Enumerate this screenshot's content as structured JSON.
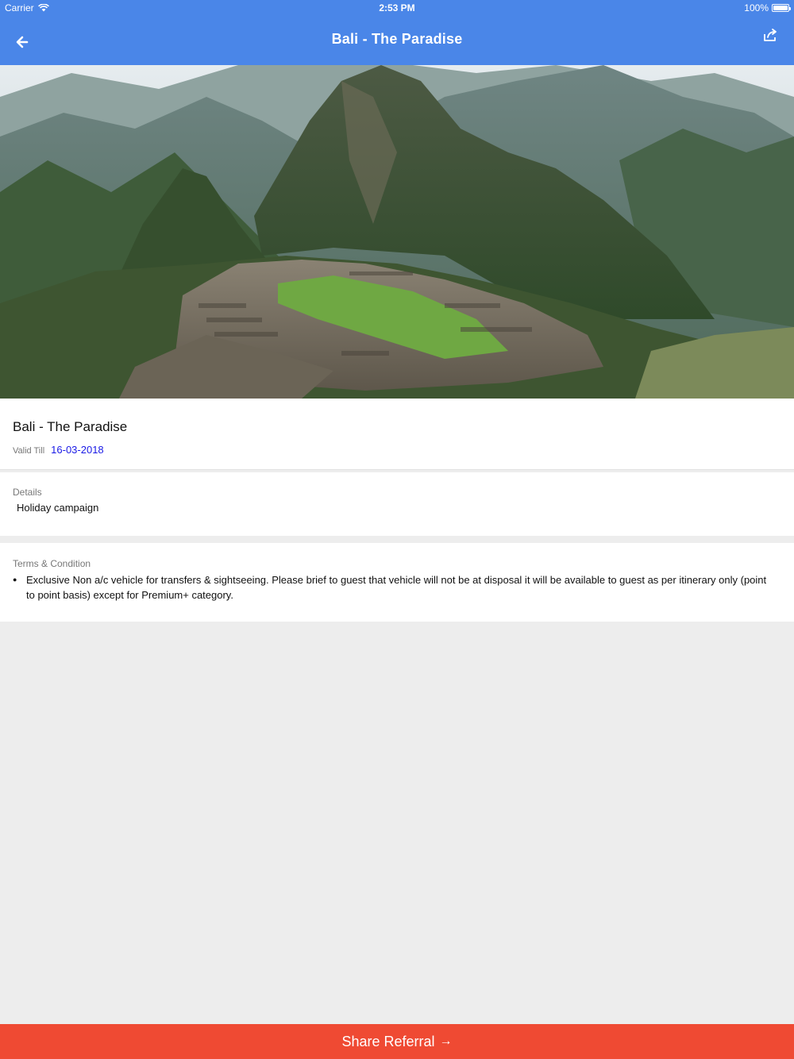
{
  "status_bar": {
    "carrier": "Carrier",
    "time": "2:53 PM",
    "battery": "100%"
  },
  "nav": {
    "title": "Bali - The Paradise",
    "back_icon": "arrow-left-icon",
    "share_icon": "share-icon"
  },
  "hero": {
    "image": "mountain-landscape"
  },
  "offer": {
    "title": "Bali - The Paradise",
    "valid_label": "Valid Till",
    "valid_date": "16-03-2018"
  },
  "details": {
    "label": "Details",
    "text": "Holiday campaign"
  },
  "terms": {
    "label": "Terms & Condition",
    "items": [
      "Exclusive Non a/c vehicle for transfers & sightseeing. Please brief to guest that vehicle will not be at disposal it will be available to guest as per itinerary only (point to point basis) except for Premium+ category."
    ]
  },
  "footer": {
    "button_label": "Share Referral",
    "button_arrow": "→"
  },
  "colors": {
    "nav": "#4a86e8",
    "cta": "#ef4a33",
    "date": "#1a1ae6"
  }
}
